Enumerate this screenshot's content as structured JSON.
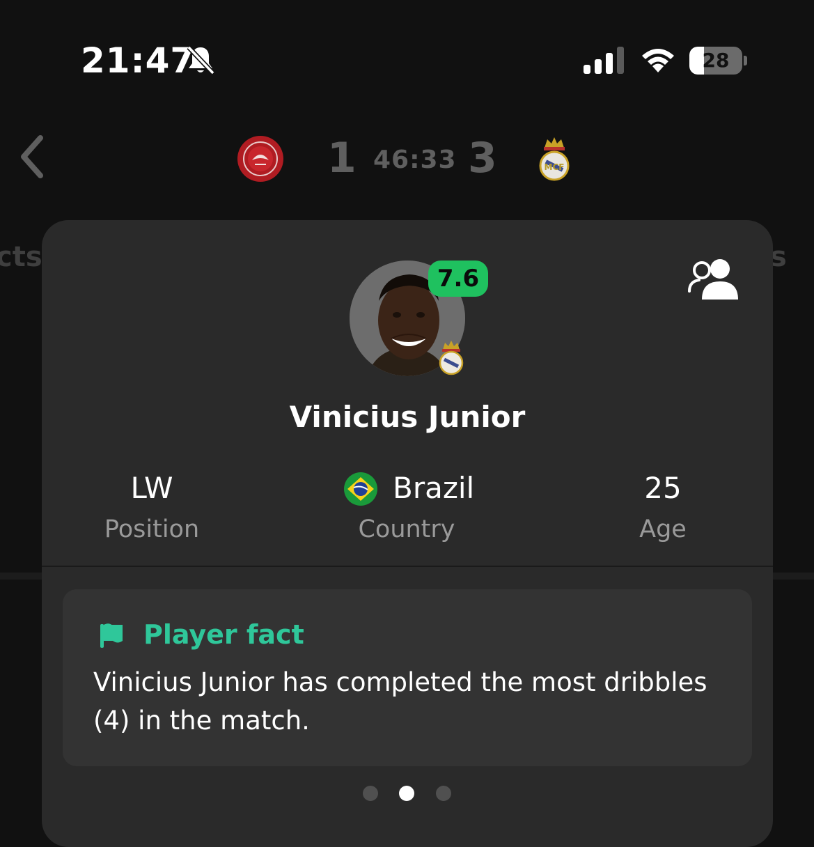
{
  "status_bar": {
    "time": "21:47",
    "battery_level": "28",
    "battery_fraction": 0.28
  },
  "match": {
    "home_score": "1",
    "away_score": "3",
    "clock": "46:33"
  },
  "background_tabs": {
    "left_fragment": "cts",
    "right_fragment": "s"
  },
  "player": {
    "name": "Vinicius Junior",
    "rating": "7.6",
    "rating_color": "#1fc15f",
    "stats": [
      {
        "value": "LW",
        "label": "Position"
      },
      {
        "value": "Brazil",
        "label": "Country",
        "icon": "brazil-flag-icon"
      },
      {
        "value": "25",
        "label": "Age"
      }
    ]
  },
  "fact": {
    "title": "Player fact",
    "accent_color": "#2fc79a",
    "text": "Vinicius Junior has completed the most dribbles (4) in the match."
  },
  "pager": {
    "total": 3,
    "active_index": 1
  },
  "icons": {
    "notifications": "bell-slash-icon",
    "back": "chevron-left-icon",
    "compare": "compare-players-icon",
    "fact": "flag-icon"
  }
}
